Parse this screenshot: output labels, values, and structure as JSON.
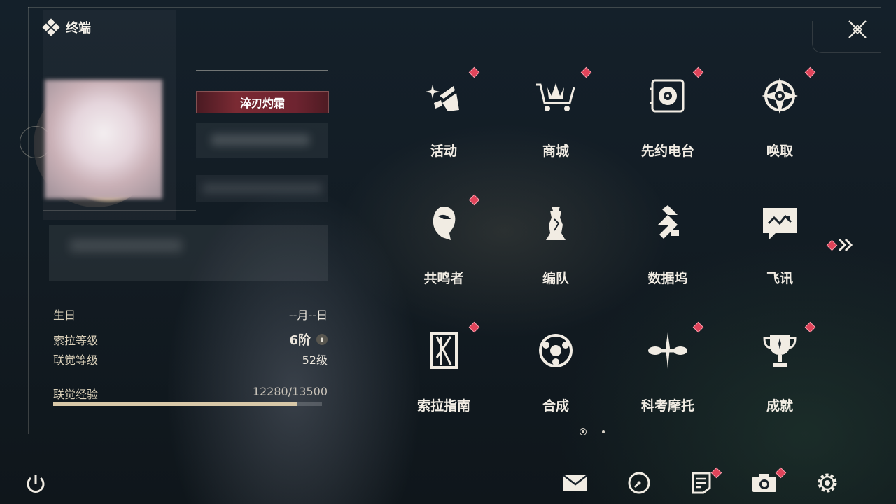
{
  "header": {
    "title": "终端"
  },
  "profile": {
    "title_badge": "淬刃灼霜"
  },
  "stats": {
    "birthday_label": "生日",
    "birthday_value": "--月--日",
    "sola_level_label": "索拉等级",
    "sola_level_value": "6阶",
    "union_level_label": "联觉等级",
    "union_level_value": "52级",
    "exp_label": "联觉经验",
    "exp_value": "12280/13500",
    "exp_progress": 0.9096
  },
  "menu": {
    "items": [
      {
        "label": "活动",
        "icon": "event-sparkle-icon",
        "badge": true
      },
      {
        "label": "商城",
        "icon": "shop-cart-icon",
        "badge": true
      },
      {
        "label": "先约电台",
        "icon": "radio-icon",
        "badge": true
      },
      {
        "label": "唤取",
        "icon": "convene-compass-icon",
        "badge": true
      },
      {
        "label": "共鸣者",
        "icon": "resonator-icon",
        "badge": true
      },
      {
        "label": "编队",
        "icon": "team-chess-icon",
        "badge": false
      },
      {
        "label": "数据坞",
        "icon": "data-bank-icon",
        "badge": false
      },
      {
        "label": "飞讯",
        "icon": "message-icon",
        "badge": false
      },
      {
        "label": "索拉指南",
        "icon": "guidebook-icon",
        "badge": true
      },
      {
        "label": "合成",
        "icon": "synthesis-icon",
        "badge": false
      },
      {
        "label": "科考摩托",
        "icon": "motorbike-icon",
        "badge": true
      },
      {
        "label": "成就",
        "icon": "trophy-icon",
        "badge": true
      }
    ]
  },
  "pager": {
    "current": 1,
    "total": 2
  },
  "bottom_bar": {
    "icons": [
      "mail-icon",
      "clock-icon",
      "notes-icon",
      "camera-icon",
      "settings-icon"
    ]
  },
  "colors": {
    "badge": "#e0445a",
    "text": "#f1ece3",
    "accent_gold": "#d8c8a8"
  }
}
